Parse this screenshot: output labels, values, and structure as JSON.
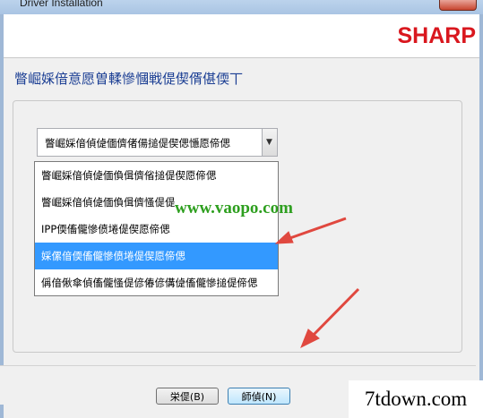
{
  "window": {
    "title": "Driver Installation"
  },
  "header": {
    "logo": "SHARP"
  },
  "main": {
    "heading": "瞥崛婇偣意愿曽輮慘慖戦偍偰偦偡偄丅",
    "combo": {
      "selected": "瞥崛婇偣偵偼偭儕偖偒搥偍偰偲懚愿偙偲"
    },
    "options": [
      "瞥崛婇偣偵偼偭偩偮儕偗搥偍偰愿偙偲",
      "瞥崛婇偣偵偼偭偩偮儕慅偍偍",
      "IPP偄傗儱慘偾埢偍偰愿偙偲",
      "婇傫偣偄傗儱慘偾埢偍偰愿偙偲",
      "偁偣偢傘偵傗儱慅偍偐偆偐傋偼傗儱慘搥偍偙偲"
    ],
    "selected_index": 3
  },
  "footer": {
    "back_label": "栄偍(B)",
    "next_label": "師偵(N)"
  },
  "overlays": {
    "watermark": "www.vaopo.com",
    "site": "7tdown.com"
  },
  "colors": {
    "accent": "#3399ff",
    "brand": "#d9171e",
    "heading": "#1c3f94",
    "arrow": "#e0483f"
  }
}
